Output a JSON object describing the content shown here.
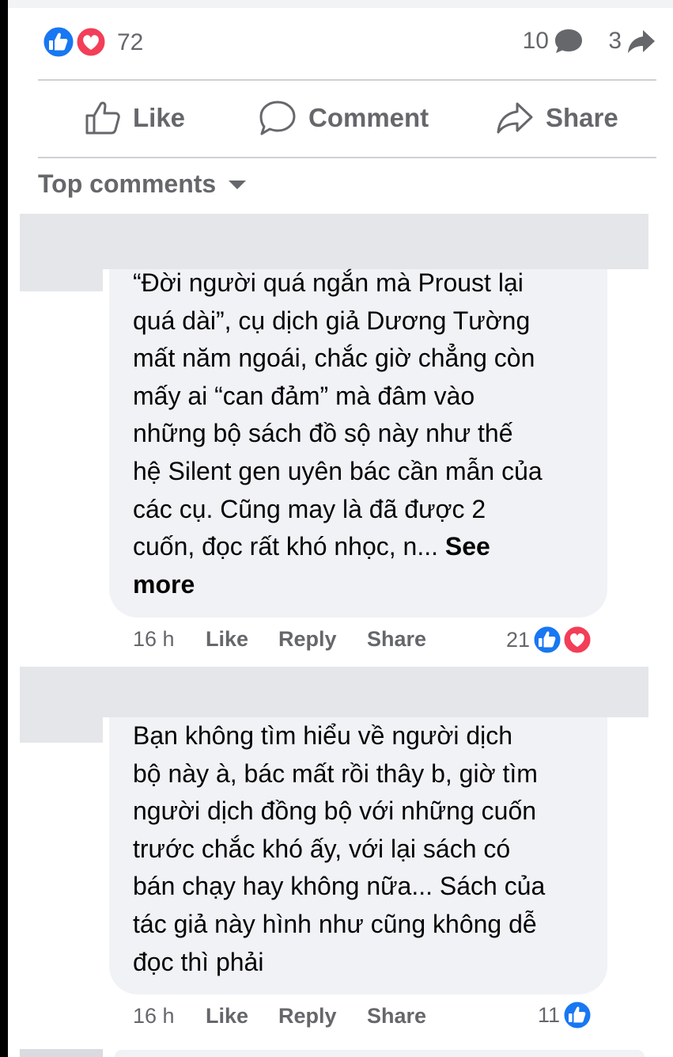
{
  "reactions": {
    "count": "72",
    "icons": [
      "like-icon",
      "love-icon"
    ]
  },
  "stats": {
    "comments": "10",
    "shares": "3"
  },
  "actions": {
    "like": "Like",
    "comment": "Comment",
    "share": "Share"
  },
  "sort": {
    "label": "Top comments"
  },
  "comments": [
    {
      "lines": [
        "“Đời người quá ngắn mà Proust lại",
        "quá dài”, cụ dịch giả Dương Tường",
        "mất năm ngoái, chắc giờ chẳng còn",
        "mấy ai “can đảm” mà đâm vào",
        "những bộ sách đồ sộ này như thế",
        "hệ Silent gen uyên bác cần mẫn của",
        "các cụ. Cũng may là đã được 2",
        "cuốn, đọc rất khó nhọc, n..."
      ],
      "see_more": "See",
      "see_more_2": "more",
      "time": "16 h",
      "like": "Like",
      "reply": "Reply",
      "share": "Share",
      "reaction_count": "21"
    },
    {
      "lines": [
        "Bạn không tìm hiểu về người dịch",
        "bộ này à, bác mất rồi thây b, giờ tìm",
        "người dịch đồng bộ với những cuốn",
        "trước chắc khó ấy, với lại sách có",
        "bán chạy hay không nữa... Sách của",
        "tác giả này hình như cũng không dễ",
        "đọc thì phải"
      ],
      "time": "16 h",
      "like": "Like",
      "reply": "Reply",
      "share": "Share",
      "reaction_count": "11"
    }
  ],
  "colors": {
    "like_blue": "#1877f2",
    "love_red": "#f33e58",
    "meta_gray": "#65676b",
    "bubble": "#f0f2f5"
  }
}
